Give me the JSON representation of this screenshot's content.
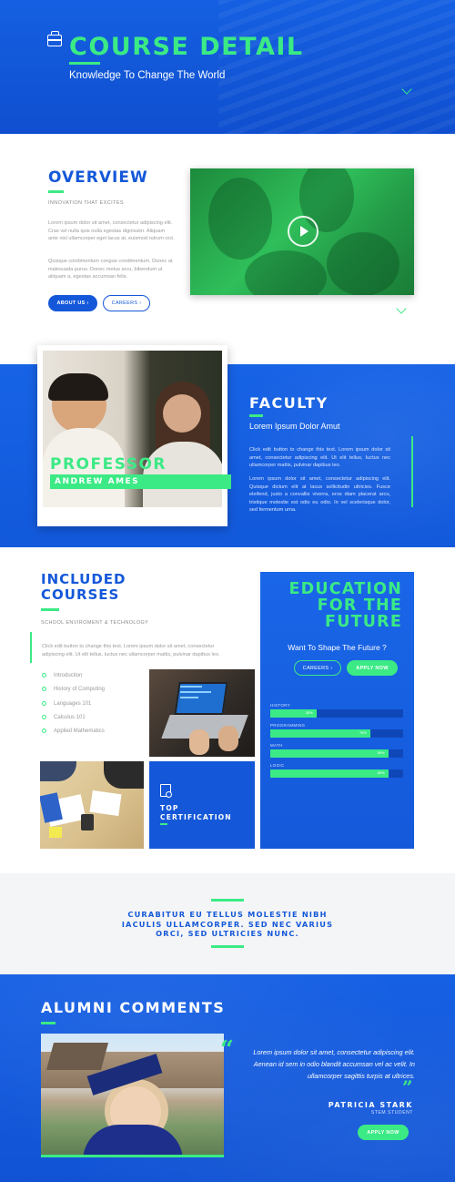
{
  "hero": {
    "title": "COURSE DETAIL",
    "subtitle": "Knowledge To Change The World",
    "icon": "briefcase-icon",
    "scroll_icon": "chevron-down-icon"
  },
  "overview": {
    "heading": "OVERVIEW",
    "tagline": "INNOVATION THAT EXCITES",
    "para1": "Lorem ipsum dolor sit amet, consectetur adipiscing elit. Cras vel nulla quis nulla egestas dignissim. Aliquam ante nisl ullamcorper eget lacus at, euismod rutrum orci.",
    "para2": "Quisque condimentum congue condimentum. Donec at malesuada purus. Donec metus arcu, bibendum ut aliquam a, egestas accumsan felis.",
    "btn_about": "ABOUT US ›",
    "btn_careers": "CAREERS ›",
    "video_icon": "play-icon"
  },
  "faculty": {
    "heading": "FACULTY",
    "subheading": "Lorem Ipsum Dolor Amut",
    "para1": "Click edit button to change this text. Lorem ipsum dolor sit amet, consectetur adipiscing elit. Ut elit tellus, luctus nec ullamcorper mattis, pulvinar dapibus leo.",
    "para2": "Lorem ipsum dolor sit amet, consectetur adipiscing elit. Quisque dictum elit at lacus sollicitudin ultricies. Fusce eleifend, justo a convallis viverra, eros diam placerat arcu, tristique molestie est odio eu odio. In vel scelerisque dolor, sed fermentum urna.",
    "professor_label": "PROFESSOR",
    "professor_name": "ANDREW AMES"
  },
  "courses": {
    "heading_line1": "INCLUDED",
    "heading_line2": "COURSES",
    "tagline": "SCHOOL ENVIROMENT & TECHNOLOGY",
    "intro": "Click edit button to change this text. Lorem ipsum dolor sit amet, consectetur adipiscing elit. Ut elit tellus, luctus nec ullamcorper mattis, pulvinar dapibus leo.",
    "items": [
      "Introduction",
      "History of Computing",
      "Languages 101",
      "Calculus 101",
      "Applied Mathematics"
    ],
    "cert_label_line1": "TOP",
    "cert_label_line2": "CERTIFICATION",
    "cert_icon": "certificate-icon"
  },
  "education": {
    "title_line1": "EDUCATION",
    "title_line2": "FOR THE",
    "title_line3": "FUTURE",
    "subtitle": "Want To Shape The Future ?",
    "btn_careers": "CAREERS ›",
    "btn_apply": "APPLY NOW",
    "skills": [
      {
        "label": "HISTORY",
        "percent": 35,
        "percent_text": "35%"
      },
      {
        "label": "PROGRAMMING",
        "percent": 75,
        "percent_text": "75%"
      },
      {
        "label": "MATH",
        "percent": 89,
        "percent_text": "89%"
      },
      {
        "label": "LOGIC",
        "percent": 89,
        "percent_text": "89%"
      }
    ]
  },
  "quote": {
    "text": "CURABITUR EU TELLUS MOLESTIE NIBH IACULIS ULLAMCORPER. SED NEC VARIUS ORCI, SED ULTRICIES NUNC."
  },
  "alumni": {
    "heading": "ALUMNI COMMENTS",
    "comment": "Lorem ipsum dolor sit amet, consectetur adipiscing elit. Aenean id sem in odio blandit accumsan vel ac velit. In ullamcorper sagittis turpis at ultrices.",
    "name": "PATRICIA STARK",
    "role": "STEM STUDENT",
    "btn_apply": "APPLY NOW",
    "quote_open": "“",
    "quote_close": "”"
  },
  "colors": {
    "brand_blue": "#1458d9",
    "accent_green": "#3bea85"
  }
}
